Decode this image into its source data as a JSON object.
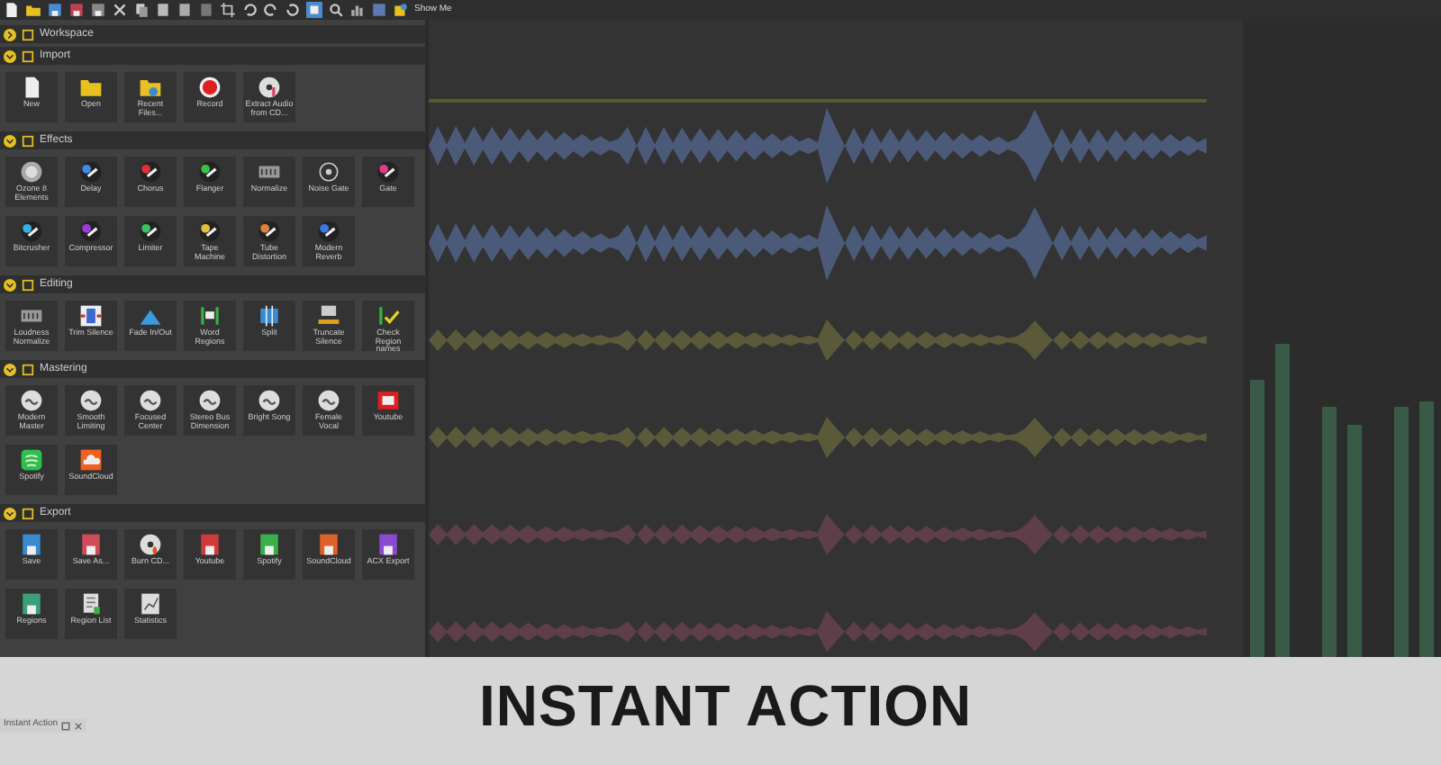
{
  "toolbar": {
    "label": "Show Me"
  },
  "sections": [
    {
      "title": "Workspace",
      "expanded": false
    },
    {
      "title": "Import",
      "expanded": true,
      "items": [
        {
          "label": "New",
          "kind": "doc"
        },
        {
          "label": "Open",
          "kind": "folder"
        },
        {
          "label": "Recent Files...",
          "kind": "recent"
        },
        {
          "label": "Record",
          "kind": "record"
        },
        {
          "label": "Extract Audio from CD...",
          "kind": "cd"
        }
      ]
    },
    {
      "title": "Effects",
      "expanded": true,
      "items": [
        {
          "label": "Ozone 8 Elements",
          "kind": "ozone"
        },
        {
          "label": "Delay",
          "kind": "knob",
          "color": "#3a8de0"
        },
        {
          "label": "Chorus",
          "kind": "knob",
          "color": "#e0303a"
        },
        {
          "label": "Flanger",
          "kind": "knob",
          "color": "#3ac040"
        },
        {
          "label": "Normalize",
          "kind": "meter"
        },
        {
          "label": "Noise Gate",
          "kind": "gate"
        },
        {
          "label": "Gate",
          "kind": "knob",
          "color": "#e03a8a"
        },
        {
          "label": "Bitcrusher",
          "kind": "knob",
          "color": "#3ab0e0"
        },
        {
          "label": "Compressor",
          "kind": "knob",
          "color": "#9a3ae0"
        },
        {
          "label": "Limiter",
          "kind": "knob",
          "color": "#3ac060"
        },
        {
          "label": "Tape Machine",
          "kind": "knob",
          "color": "#e0c03a"
        },
        {
          "label": "Tube Distortion",
          "kind": "knob",
          "color": "#e0803a"
        },
        {
          "label": "Modern Reverb",
          "kind": "knob",
          "color": "#3a7ae0"
        }
      ]
    },
    {
      "title": "Editing",
      "expanded": true,
      "items": [
        {
          "label": "Loudness Normalize",
          "kind": "meter"
        },
        {
          "label": "Trim Silence",
          "kind": "trim"
        },
        {
          "label": "Fade In/Out",
          "kind": "fade"
        },
        {
          "label": "Word Regions",
          "kind": "flags"
        },
        {
          "label": "Split",
          "kind": "split"
        },
        {
          "label": "Truncate Silence",
          "kind": "truncate"
        },
        {
          "label": "Check Region names",
          "kind": "check"
        }
      ]
    },
    {
      "title": "Mastering",
      "expanded": true,
      "items": [
        {
          "label": "Modern Master",
          "kind": "preset"
        },
        {
          "label": "Smooth Limiting",
          "kind": "preset"
        },
        {
          "label": "Focused Center",
          "kind": "preset"
        },
        {
          "label": "Stereo Bus Dimension",
          "kind": "preset"
        },
        {
          "label": "Bright Song",
          "kind": "preset"
        },
        {
          "label": "Female Vocal",
          "kind": "preset"
        },
        {
          "label": "Youtube",
          "kind": "play"
        },
        {
          "label": "Spotify",
          "kind": "bars"
        },
        {
          "label": "SoundCloud",
          "kind": "cloud"
        }
      ]
    },
    {
      "title": "Export",
      "expanded": true,
      "items": [
        {
          "label": "Save",
          "kind": "floppy",
          "color": "#3a8ad0"
        },
        {
          "label": "Save As...",
          "kind": "floppy",
          "color": "#d04a5a"
        },
        {
          "label": "Burn CD...",
          "kind": "burn"
        },
        {
          "label": "Youtube",
          "kind": "floppy",
          "color": "#d03a3a"
        },
        {
          "label": "Spotify",
          "kind": "floppy",
          "color": "#3ab04a"
        },
        {
          "label": "SoundCloud",
          "kind": "floppy",
          "color": "#e0602a"
        },
        {
          "label": "ACX Export",
          "kind": "floppy",
          "color": "#8a4ad0"
        },
        {
          "label": "Regions",
          "kind": "floppy",
          "color": "#3aa07a"
        },
        {
          "label": "Region List",
          "kind": "list"
        },
        {
          "label": "Statistics",
          "kind": "stats"
        }
      ]
    }
  ],
  "panel_tab": {
    "title": "Instant Action"
  },
  "caption": "INSTANT ACTION"
}
